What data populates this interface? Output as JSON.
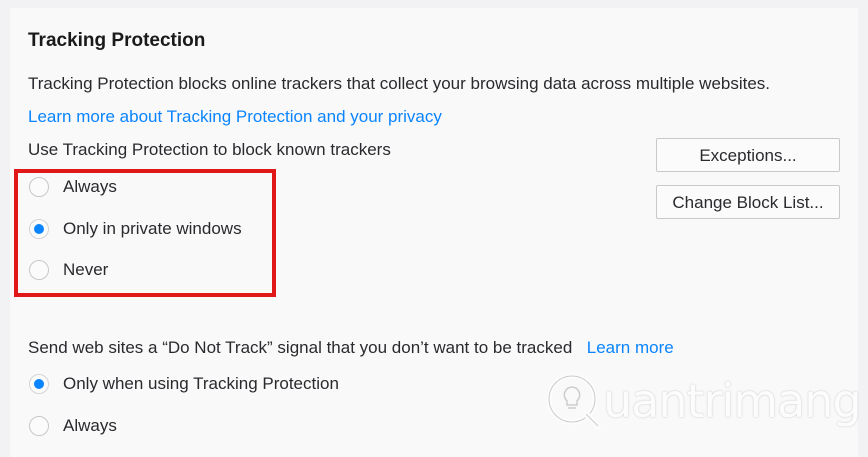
{
  "section": {
    "title": "Tracking Protection",
    "description": "Tracking Protection blocks online trackers that collect your browsing data across multiple websites.",
    "learn_more_link": "Learn more about Tracking Protection and your privacy",
    "use_label": "Use Tracking Protection to block known trackers",
    "options": [
      {
        "label": "Always",
        "checked": false
      },
      {
        "label": "Only in private windows",
        "checked": true
      },
      {
        "label": "Never",
        "checked": false
      }
    ],
    "buttons": {
      "exceptions": "Exceptions...",
      "change_block_list": "Change Block List..."
    }
  },
  "dnt": {
    "label": "Send web sites a “Do Not Track” signal that you don’t want to be tracked",
    "learn_more": "Learn more",
    "options": [
      {
        "label": "Only when using Tracking Protection",
        "checked": true
      },
      {
        "label": "Always",
        "checked": false
      }
    ]
  },
  "watermark": {
    "text": "uantrimang",
    "icon": "q-lightbulb-logo-icon"
  },
  "colors": {
    "accent": "#0a84ff",
    "highlight": "#e01818",
    "panel_bg": "#f9f9fa"
  }
}
